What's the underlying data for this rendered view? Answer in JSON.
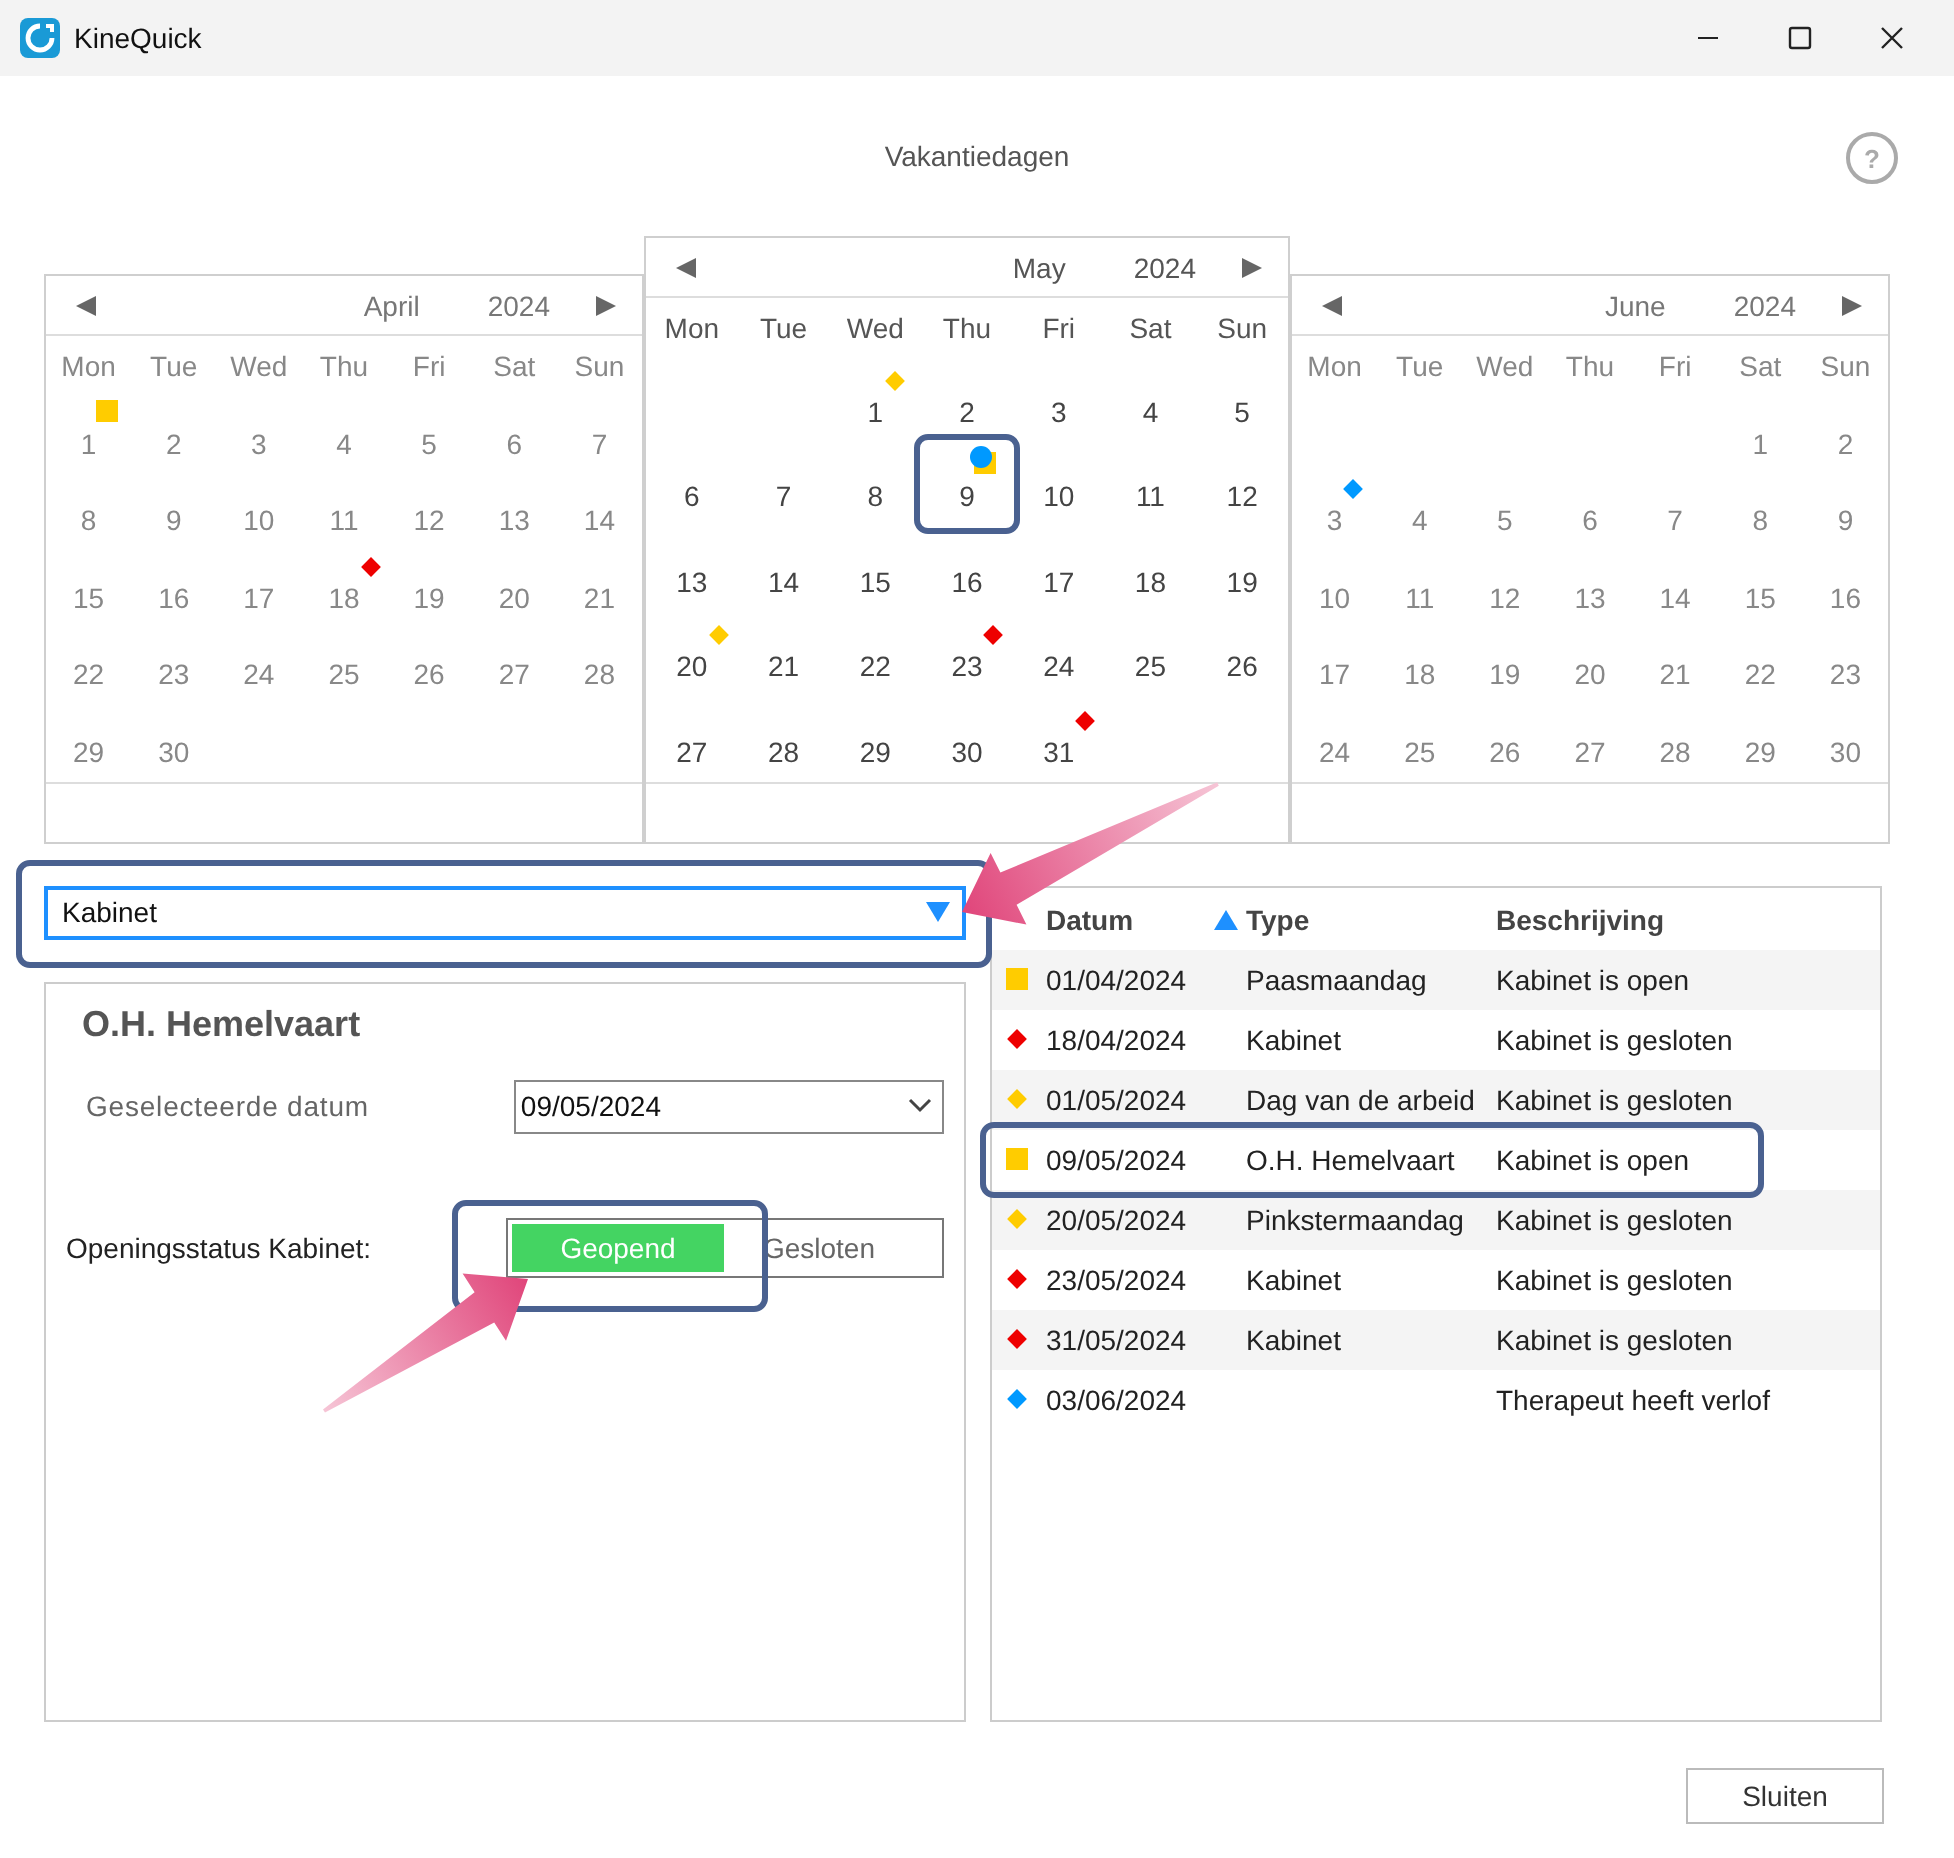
{
  "window": {
    "title": "KineQuick"
  },
  "heading": "Vakantiedagen",
  "help_button": "?",
  "calendars": [
    {
      "month": "April",
      "year": "2024",
      "focused": false,
      "weekdays": [
        "Mon",
        "Tue",
        "Wed",
        "Thu",
        "Fri",
        "Sat",
        "Sun"
      ],
      "weeks": [
        [
          {
            "kind": "day",
            "day": "1",
            "markers": [
              {
                "kind": "square",
                "color": "#ffcc00"
              }
            ]
          },
          {
            "kind": "day",
            "day": "2"
          },
          {
            "kind": "day",
            "day": "3"
          },
          {
            "kind": "day",
            "day": "4"
          },
          {
            "kind": "day",
            "day": "5"
          },
          {
            "kind": "day",
            "day": "6"
          },
          {
            "kind": "day",
            "day": "7"
          }
        ],
        [
          {
            "kind": "day",
            "day": "8"
          },
          {
            "kind": "day",
            "day": "9"
          },
          {
            "kind": "day",
            "day": "10"
          },
          {
            "kind": "day",
            "day": "11"
          },
          {
            "kind": "day",
            "day": "12"
          },
          {
            "kind": "day",
            "day": "13"
          },
          {
            "kind": "day",
            "day": "14"
          }
        ],
        [
          {
            "kind": "day",
            "day": "15"
          },
          {
            "kind": "day",
            "day": "16"
          },
          {
            "kind": "day",
            "day": "17"
          },
          {
            "kind": "day",
            "day": "18",
            "markers": [
              {
                "kind": "diamond",
                "color": "#ee0000"
              }
            ]
          },
          {
            "kind": "day",
            "day": "19"
          },
          {
            "kind": "day",
            "day": "20"
          },
          {
            "kind": "day",
            "day": "21"
          }
        ],
        [
          {
            "kind": "day",
            "day": "22"
          },
          {
            "kind": "day",
            "day": "23"
          },
          {
            "kind": "day",
            "day": "24"
          },
          {
            "kind": "day",
            "day": "25"
          },
          {
            "kind": "day",
            "day": "26"
          },
          {
            "kind": "day",
            "day": "27"
          },
          {
            "kind": "day",
            "day": "28"
          }
        ],
        [
          {
            "kind": "day",
            "day": "29"
          },
          {
            "kind": "day",
            "day": "30"
          },
          {
            "kind": "blank"
          },
          {
            "kind": "blank"
          },
          {
            "kind": "blank"
          },
          {
            "kind": "blank"
          },
          {
            "kind": "blank"
          }
        ]
      ]
    },
    {
      "month": "May",
      "year": "2024",
      "focused": true,
      "weekdays": [
        "Mon",
        "Tue",
        "Wed",
        "Thu",
        "Fri",
        "Sat",
        "Sun"
      ],
      "weeks": [
        [
          {
            "kind": "blank"
          },
          {
            "kind": "blank"
          },
          {
            "kind": "day",
            "day": "1",
            "markers": [
              {
                "kind": "diamond",
                "color": "#ffcc00"
              }
            ]
          },
          {
            "kind": "day",
            "day": "2"
          },
          {
            "kind": "day",
            "day": "3"
          },
          {
            "kind": "day",
            "day": "4"
          },
          {
            "kind": "day",
            "day": "5"
          }
        ],
        [
          {
            "kind": "day",
            "day": "6"
          },
          {
            "kind": "day",
            "day": "7"
          },
          {
            "kind": "day",
            "day": "8"
          },
          {
            "kind": "day",
            "day": "9",
            "highlighted": true,
            "markers": [
              {
                "kind": "square",
                "color": "#ffcc00"
              },
              {
                "kind": "circle",
                "color": "#0099ff"
              }
            ]
          },
          {
            "kind": "day",
            "day": "10"
          },
          {
            "kind": "day",
            "day": "11"
          },
          {
            "kind": "day",
            "day": "12"
          }
        ],
        [
          {
            "kind": "day",
            "day": "13"
          },
          {
            "kind": "day",
            "day": "14"
          },
          {
            "kind": "day",
            "day": "15"
          },
          {
            "kind": "day",
            "day": "16"
          },
          {
            "kind": "day",
            "day": "17"
          },
          {
            "kind": "day",
            "day": "18"
          },
          {
            "kind": "day",
            "day": "19"
          }
        ],
        [
          {
            "kind": "day",
            "day": "20",
            "markers": [
              {
                "kind": "diamond",
                "color": "#ffcc00"
              }
            ]
          },
          {
            "kind": "day",
            "day": "21"
          },
          {
            "kind": "day",
            "day": "22"
          },
          {
            "kind": "day",
            "day": "23",
            "markers": [
              {
                "kind": "diamond",
                "color": "#ee0000"
              }
            ]
          },
          {
            "kind": "day",
            "day": "24"
          },
          {
            "kind": "day",
            "day": "25"
          },
          {
            "kind": "day",
            "day": "26"
          }
        ],
        [
          {
            "kind": "day",
            "day": "27"
          },
          {
            "kind": "day",
            "day": "28"
          },
          {
            "kind": "day",
            "day": "29"
          },
          {
            "kind": "day",
            "day": "30"
          },
          {
            "kind": "day",
            "day": "31",
            "markers": [
              {
                "kind": "diamond",
                "color": "#ee0000"
              }
            ]
          },
          {
            "kind": "blank"
          },
          {
            "kind": "blank"
          }
        ]
      ]
    },
    {
      "month": "June",
      "year": "2024",
      "focused": false,
      "weekdays": [
        "Mon",
        "Tue",
        "Wed",
        "Thu",
        "Fri",
        "Sat",
        "Sun"
      ],
      "weeks": [
        [
          {
            "kind": "blank"
          },
          {
            "kind": "blank"
          },
          {
            "kind": "blank"
          },
          {
            "kind": "blank"
          },
          {
            "kind": "blank"
          },
          {
            "kind": "day",
            "day": "1"
          },
          {
            "kind": "day",
            "day": "2"
          }
        ],
        [
          {
            "kind": "day",
            "day": "3",
            "markers": [
              {
                "kind": "diamond",
                "color": "#0099ff"
              }
            ]
          },
          {
            "kind": "day",
            "day": "4"
          },
          {
            "kind": "day",
            "day": "5"
          },
          {
            "kind": "day",
            "day": "6"
          },
          {
            "kind": "day",
            "day": "7"
          },
          {
            "kind": "day",
            "day": "8"
          },
          {
            "kind": "day",
            "day": "9"
          }
        ],
        [
          {
            "kind": "day",
            "day": "10"
          },
          {
            "kind": "day",
            "day": "11"
          },
          {
            "kind": "day",
            "day": "12"
          },
          {
            "kind": "day",
            "day": "13"
          },
          {
            "kind": "day",
            "day": "14"
          },
          {
            "kind": "day",
            "day": "15"
          },
          {
            "kind": "day",
            "day": "16"
          }
        ],
        [
          {
            "kind": "day",
            "day": "17"
          },
          {
            "kind": "day",
            "day": "18"
          },
          {
            "kind": "day",
            "day": "19"
          },
          {
            "kind": "day",
            "day": "20"
          },
          {
            "kind": "day",
            "day": "21"
          },
          {
            "kind": "day",
            "day": "22"
          },
          {
            "kind": "day",
            "day": "23"
          }
        ],
        [
          {
            "kind": "day",
            "day": "24"
          },
          {
            "kind": "day",
            "day": "25"
          },
          {
            "kind": "day",
            "day": "26"
          },
          {
            "kind": "day",
            "day": "27"
          },
          {
            "kind": "day",
            "day": "28"
          },
          {
            "kind": "day",
            "day": "29"
          },
          {
            "kind": "day",
            "day": "30"
          }
        ]
      ]
    }
  ],
  "filter_dropdown": {
    "value": "Kabinet",
    "highlighted": true,
    "pointer_arrow": true
  },
  "detail": {
    "title": "O.H. Hemelvaart",
    "date_label": "Geselecteerde datum",
    "date_value": "09/05/2024",
    "status_label": "Openingsstatus Kabinet:",
    "status_options": [
      {
        "label": "Geopend",
        "selected": true
      },
      {
        "label": "Gesloten",
        "selected": false
      }
    ],
    "status_highlighted": true,
    "status_pointer_arrow": true
  },
  "holiday_list": {
    "columns": [
      {
        "label": "Datum",
        "sort_ascending": true
      },
      {
        "label": "Type"
      },
      {
        "label": "Beschrijving"
      }
    ],
    "rows": [
      {
        "marker": {
          "kind": "square",
          "color": "#ffcc00"
        },
        "date": "01/04/2024",
        "type": "Paasmaandag",
        "description": "Kabinet is open",
        "highlighted": false
      },
      {
        "marker": {
          "kind": "diamond",
          "color": "#ee0000"
        },
        "date": "18/04/2024",
        "type": "Kabinet",
        "description": "Kabinet is gesloten",
        "highlighted": false
      },
      {
        "marker": {
          "kind": "diamond",
          "color": "#ffcc00"
        },
        "date": "01/05/2024",
        "type": "Dag van de arbeid",
        "description": "Kabinet is gesloten",
        "highlighted": false
      },
      {
        "marker": {
          "kind": "square",
          "color": "#ffcc00"
        },
        "date": "09/05/2024",
        "type": "O.H. Hemelvaart",
        "description": "Kabinet is open",
        "highlighted": true
      },
      {
        "marker": {
          "kind": "diamond",
          "color": "#ffcc00"
        },
        "date": "20/05/2024",
        "type": "Pinkstermaandag",
        "description": "Kabinet is gesloten",
        "highlighted": false
      },
      {
        "marker": {
          "kind": "diamond",
          "color": "#ee0000"
        },
        "date": "23/05/2024",
        "type": "Kabinet",
        "description": "Kabinet is gesloten",
        "highlighted": false
      },
      {
        "marker": {
          "kind": "diamond",
          "color": "#ee0000"
        },
        "date": "31/05/2024",
        "type": "Kabinet",
        "description": "Kabinet is gesloten",
        "highlighted": false
      },
      {
        "marker": {
          "kind": "diamond",
          "color": "#0099ff"
        },
        "date": "03/06/2024",
        "description": "Therapeut heeft verlof",
        "highlighted": false
      }
    ]
  },
  "buttons": [
    "Sluiten"
  ]
}
